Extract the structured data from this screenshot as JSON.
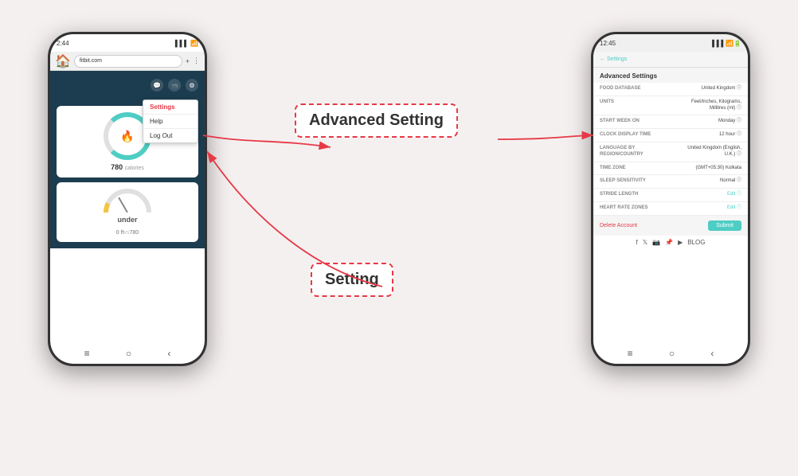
{
  "background_color": "#f5f0f0",
  "left_phone": {
    "status_bar": {
      "time": "2:44",
      "signal": "▌▌▌",
      "battery": "⬛"
    },
    "browser": {
      "url": "fitbit.com",
      "plus": "+",
      "menu": "⋮"
    },
    "dropdown": {
      "items": [
        "Settings",
        "Help",
        "Log Out"
      ]
    },
    "calories": {
      "value": "780",
      "unit": "calories"
    },
    "activity": {
      "label": "under",
      "stats_left": "0 ft",
      "stats_vs": "vs",
      "stats_right": "780"
    }
  },
  "right_phone": {
    "status_bar": {
      "time": "12:45",
      "signal": "▌▌▌"
    },
    "section_title": "Advanced Settings",
    "rows": [
      {
        "label": "FOOD DATABASE",
        "value": "United Kingdom"
      },
      {
        "label": "UNITS",
        "value": "Feet/Inches, Kilograms, Millitres (ml)"
      },
      {
        "label": "START WEEK ON",
        "value": "Monday"
      },
      {
        "label": "CLOCK DISPLAY TIME",
        "value": "12 hour"
      },
      {
        "label": "LANGUAGE BY REGION/COUNTRY",
        "value": "United Kingdom (English, U.K.)"
      },
      {
        "label": "TIME ZONE",
        "value": "(GMT+05:30) Kolkata"
      },
      {
        "label": "SLEEP SENSITIVITY",
        "value": "Normal"
      },
      {
        "label": "STRIDE LENGTH",
        "value": "Edit"
      },
      {
        "label": "HEART RATE ZONES",
        "value": "Edit"
      }
    ],
    "footer": {
      "delete_label": "Delete Account",
      "submit_label": "Submit"
    },
    "social": [
      "f",
      "𝕏",
      "📷",
      "📌",
      "▶",
      "BLOG"
    ]
  },
  "annotations": {
    "top": "Advanced  Setting",
    "bottom": "Setting"
  },
  "colors": {
    "accent_teal": "#4ecdc4",
    "accent_red": "#e63946",
    "phone_dark": "#1a1a1a",
    "fitbit_dark": "#1c3d4f"
  }
}
